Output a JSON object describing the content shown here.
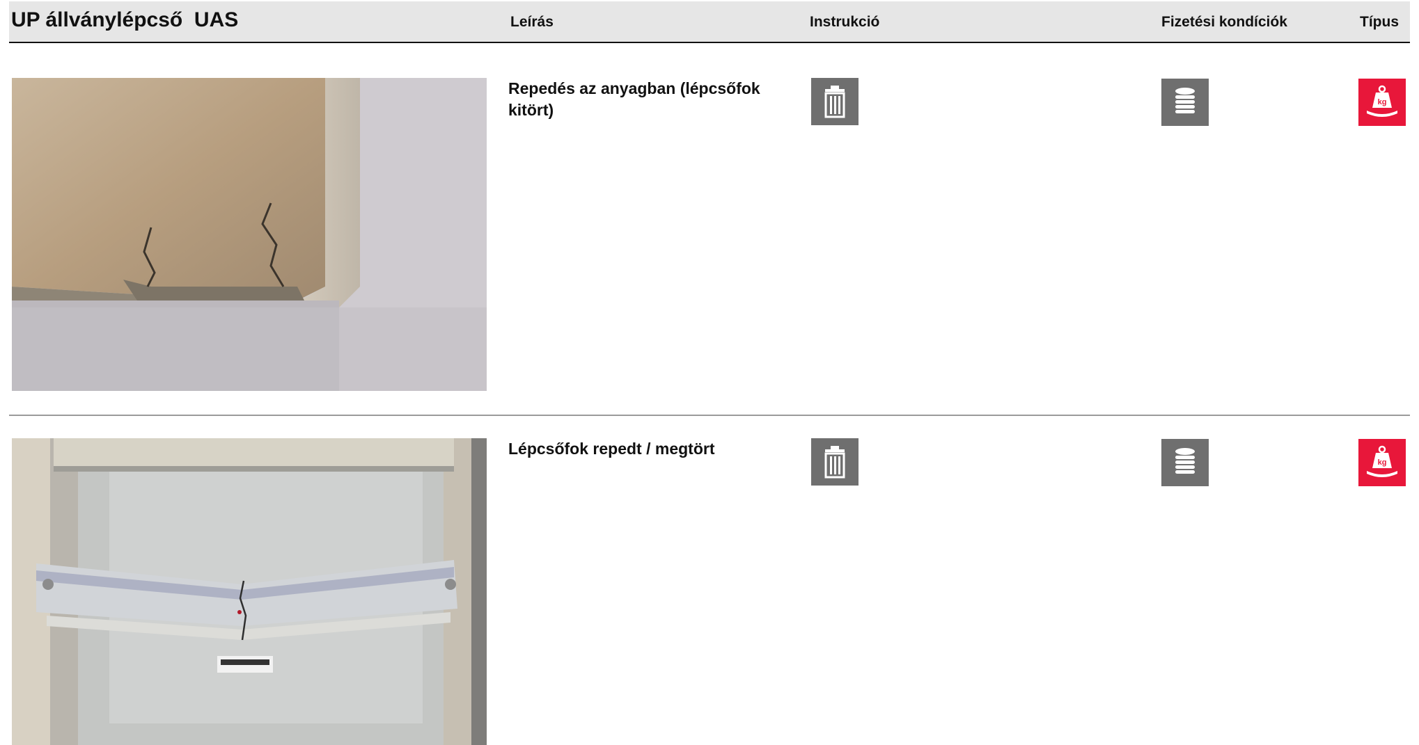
{
  "header": {
    "title": "UP állványlépcső  UAS",
    "col_description": "Leírás",
    "col_instruction": "Instrukció",
    "col_payment": "Fizetési kondíciók",
    "col_type": "Típus"
  },
  "rows": [
    {
      "description": "Repedés az anyagban (lépcsőfok kitört)",
      "photo_icon": "cracked-step-corner-photo",
      "instruction_icon": "trash-icon",
      "payment_icon": "coin-stack-icon",
      "type_icon": "weight-kg-icon"
    },
    {
      "description": "Lépcsőfok repedt / megtört",
      "photo_icon": "broken-step-photo",
      "instruction_icon": "trash-icon",
      "payment_icon": "coin-stack-icon",
      "type_icon": "weight-kg-icon"
    }
  ],
  "icons": {
    "kg_label": "kg"
  },
  "colors": {
    "icon_gray": "#6f6f6f",
    "type_red": "#e8173a",
    "header_bg": "#e6e6e6"
  }
}
